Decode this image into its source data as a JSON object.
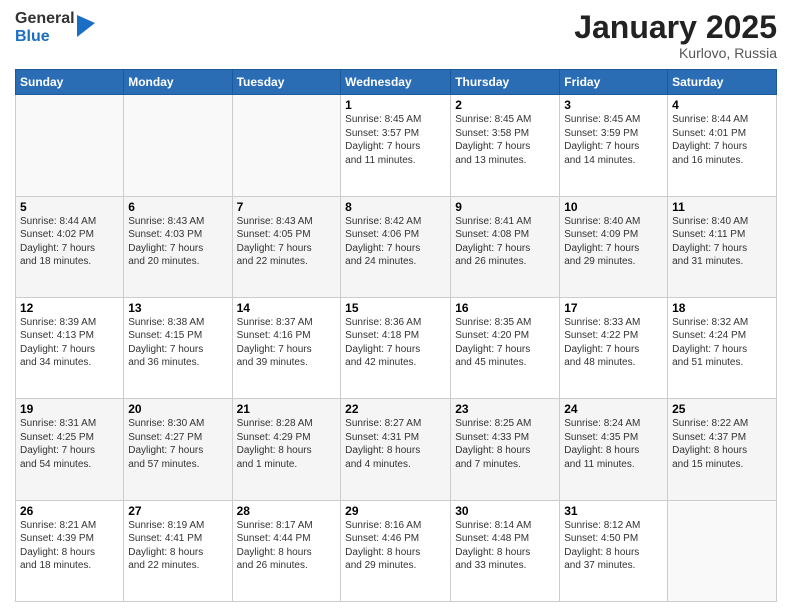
{
  "logo": {
    "general": "General",
    "blue": "Blue"
  },
  "header": {
    "month": "January 2025",
    "location": "Kurlovo, Russia"
  },
  "weekdays": [
    "Sunday",
    "Monday",
    "Tuesday",
    "Wednesday",
    "Thursday",
    "Friday",
    "Saturday"
  ],
  "weeks": [
    [
      {
        "num": "",
        "info": ""
      },
      {
        "num": "",
        "info": ""
      },
      {
        "num": "",
        "info": ""
      },
      {
        "num": "1",
        "info": "Sunrise: 8:45 AM\nSunset: 3:57 PM\nDaylight: 7 hours\nand 11 minutes."
      },
      {
        "num": "2",
        "info": "Sunrise: 8:45 AM\nSunset: 3:58 PM\nDaylight: 7 hours\nand 13 minutes."
      },
      {
        "num": "3",
        "info": "Sunrise: 8:45 AM\nSunset: 3:59 PM\nDaylight: 7 hours\nand 14 minutes."
      },
      {
        "num": "4",
        "info": "Sunrise: 8:44 AM\nSunset: 4:01 PM\nDaylight: 7 hours\nand 16 minutes."
      }
    ],
    [
      {
        "num": "5",
        "info": "Sunrise: 8:44 AM\nSunset: 4:02 PM\nDaylight: 7 hours\nand 18 minutes."
      },
      {
        "num": "6",
        "info": "Sunrise: 8:43 AM\nSunset: 4:03 PM\nDaylight: 7 hours\nand 20 minutes."
      },
      {
        "num": "7",
        "info": "Sunrise: 8:43 AM\nSunset: 4:05 PM\nDaylight: 7 hours\nand 22 minutes."
      },
      {
        "num": "8",
        "info": "Sunrise: 8:42 AM\nSunset: 4:06 PM\nDaylight: 7 hours\nand 24 minutes."
      },
      {
        "num": "9",
        "info": "Sunrise: 8:41 AM\nSunset: 4:08 PM\nDaylight: 7 hours\nand 26 minutes."
      },
      {
        "num": "10",
        "info": "Sunrise: 8:40 AM\nSunset: 4:09 PM\nDaylight: 7 hours\nand 29 minutes."
      },
      {
        "num": "11",
        "info": "Sunrise: 8:40 AM\nSunset: 4:11 PM\nDaylight: 7 hours\nand 31 minutes."
      }
    ],
    [
      {
        "num": "12",
        "info": "Sunrise: 8:39 AM\nSunset: 4:13 PM\nDaylight: 7 hours\nand 34 minutes."
      },
      {
        "num": "13",
        "info": "Sunrise: 8:38 AM\nSunset: 4:15 PM\nDaylight: 7 hours\nand 36 minutes."
      },
      {
        "num": "14",
        "info": "Sunrise: 8:37 AM\nSunset: 4:16 PM\nDaylight: 7 hours\nand 39 minutes."
      },
      {
        "num": "15",
        "info": "Sunrise: 8:36 AM\nSunset: 4:18 PM\nDaylight: 7 hours\nand 42 minutes."
      },
      {
        "num": "16",
        "info": "Sunrise: 8:35 AM\nSunset: 4:20 PM\nDaylight: 7 hours\nand 45 minutes."
      },
      {
        "num": "17",
        "info": "Sunrise: 8:33 AM\nSunset: 4:22 PM\nDaylight: 7 hours\nand 48 minutes."
      },
      {
        "num": "18",
        "info": "Sunrise: 8:32 AM\nSunset: 4:24 PM\nDaylight: 7 hours\nand 51 minutes."
      }
    ],
    [
      {
        "num": "19",
        "info": "Sunrise: 8:31 AM\nSunset: 4:25 PM\nDaylight: 7 hours\nand 54 minutes."
      },
      {
        "num": "20",
        "info": "Sunrise: 8:30 AM\nSunset: 4:27 PM\nDaylight: 7 hours\nand 57 minutes."
      },
      {
        "num": "21",
        "info": "Sunrise: 8:28 AM\nSunset: 4:29 PM\nDaylight: 8 hours\nand 1 minute."
      },
      {
        "num": "22",
        "info": "Sunrise: 8:27 AM\nSunset: 4:31 PM\nDaylight: 8 hours\nand 4 minutes."
      },
      {
        "num": "23",
        "info": "Sunrise: 8:25 AM\nSunset: 4:33 PM\nDaylight: 8 hours\nand 7 minutes."
      },
      {
        "num": "24",
        "info": "Sunrise: 8:24 AM\nSunset: 4:35 PM\nDaylight: 8 hours\nand 11 minutes."
      },
      {
        "num": "25",
        "info": "Sunrise: 8:22 AM\nSunset: 4:37 PM\nDaylight: 8 hours\nand 15 minutes."
      }
    ],
    [
      {
        "num": "26",
        "info": "Sunrise: 8:21 AM\nSunset: 4:39 PM\nDaylight: 8 hours\nand 18 minutes."
      },
      {
        "num": "27",
        "info": "Sunrise: 8:19 AM\nSunset: 4:41 PM\nDaylight: 8 hours\nand 22 minutes."
      },
      {
        "num": "28",
        "info": "Sunrise: 8:17 AM\nSunset: 4:44 PM\nDaylight: 8 hours\nand 26 minutes."
      },
      {
        "num": "29",
        "info": "Sunrise: 8:16 AM\nSunset: 4:46 PM\nDaylight: 8 hours\nand 29 minutes."
      },
      {
        "num": "30",
        "info": "Sunrise: 8:14 AM\nSunset: 4:48 PM\nDaylight: 8 hours\nand 33 minutes."
      },
      {
        "num": "31",
        "info": "Sunrise: 8:12 AM\nSunset: 4:50 PM\nDaylight: 8 hours\nand 37 minutes."
      },
      {
        "num": "",
        "info": ""
      }
    ]
  ]
}
